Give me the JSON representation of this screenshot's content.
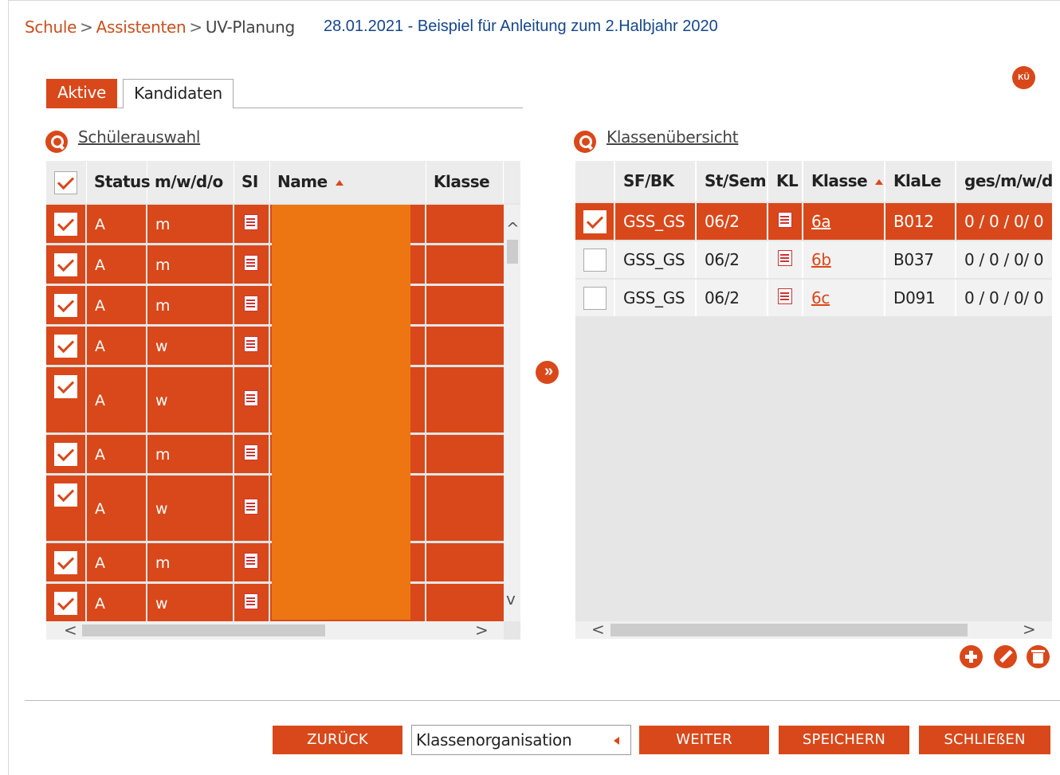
{
  "breadcrumb": {
    "items": [
      "Schule",
      "Assistenten",
      "UV-Planung"
    ],
    "separator": ">"
  },
  "page_title": "28.01.2021 - Beispiel für Anleitung zum 2.Halbjahr 2020",
  "ku_badge": "KÜ",
  "tabs": [
    {
      "label": "Aktive",
      "active": true
    },
    {
      "label": "Kandidaten",
      "active": false
    }
  ],
  "left_panel": {
    "title": "Schülerauswahl",
    "columns": [
      "Status",
      "m/w/d/o",
      "SI",
      "Name",
      "Klasse"
    ],
    "rows": [
      {
        "checked": true,
        "status": "A",
        "gender": "m"
      },
      {
        "checked": true,
        "status": "A",
        "gender": "m"
      },
      {
        "checked": true,
        "status": "A",
        "gender": "m"
      },
      {
        "checked": true,
        "status": "A",
        "gender": "w"
      },
      {
        "checked": true,
        "status": "A",
        "gender": "w"
      },
      {
        "checked": true,
        "status": "A",
        "gender": "m"
      },
      {
        "checked": true,
        "status": "A",
        "gender": "w"
      },
      {
        "checked": true,
        "status": "A",
        "gender": "m"
      },
      {
        "checked": true,
        "status": "A",
        "gender": "w"
      }
    ]
  },
  "right_panel": {
    "title": "Klassenübersicht",
    "columns": [
      "SF/BK",
      "St/Sem",
      "KL",
      "Klasse",
      "KlaLe",
      "ges/m/w/d"
    ],
    "rows": [
      {
        "checked": true,
        "sfbk": "GSS_GS",
        "stsem": "06/2",
        "klasse": "6a",
        "klale": "B012",
        "counts": "0 / 0 / 0/ 0"
      },
      {
        "checked": false,
        "sfbk": "GSS_GS",
        "stsem": "06/2",
        "klasse": "6b",
        "klale": "B037",
        "counts": "0 / 0 / 0/ 0"
      },
      {
        "checked": false,
        "sfbk": "GSS_GS",
        "stsem": "06/2",
        "klasse": "6c",
        "klale": "D091",
        "counts": "0 / 0 / 0/ 0"
      }
    ]
  },
  "scroll_arrows": {
    "up": "^",
    "down": "v",
    "left": "<",
    "right": ">"
  },
  "move_button": "»",
  "footer": {
    "back": "ZURÜCK",
    "select_value": "Klassenorganisation",
    "next": "WEITER",
    "save": "SPEICHERN",
    "close": "SCHLIEßEN"
  },
  "colors": {
    "accent": "#d9481a",
    "name_block": "#ed7613",
    "title_blue": "#15468a"
  }
}
